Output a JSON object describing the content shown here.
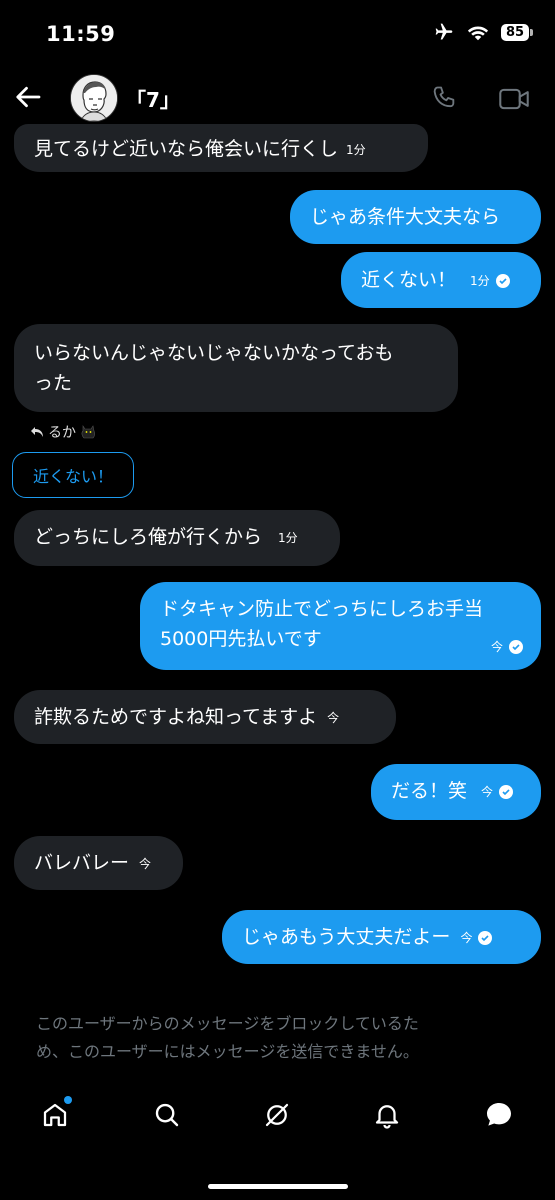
{
  "status": {
    "time": "11:59",
    "battery": "85"
  },
  "header": {
    "title": "「7」"
  },
  "messages": {
    "m1": {
      "text": "見てるけど近いなら俺会いに行くし",
      "time": "1分"
    },
    "m2": {
      "text": "じゃあ条件大文夫なら"
    },
    "m3": {
      "text": "近くない！",
      "time": "1分"
    },
    "m4": {
      "line1": "いらないんじゃないじゃないかなっておも",
      "line2": "った"
    },
    "reply_ref": "るか",
    "quote": "近くない！",
    "m5": {
      "text": "どっちにしろ俺が行くから",
      "time": "1分"
    },
    "m6": {
      "line1": "ドタキャン防止でどっちにしろお手当",
      "line2": "5000円先払いです",
      "time": "今"
    },
    "m7": {
      "text": "詐欺るためですよね知ってますよ",
      "time": "今"
    },
    "m8": {
      "text": "だる！笑",
      "time": "今"
    },
    "m9": {
      "text": "バレバレー",
      "time": "今"
    },
    "m10": {
      "text": "じゃあもう大丈夫だよー",
      "time": "今"
    }
  },
  "blocked_notice": {
    "line1": "このユーザーからのメッセージをブロックしているた",
    "line2": "め、このユーザーにはメッセージを送信できません。"
  },
  "icons": [
    "back-arrow-icon",
    "phone-icon",
    "video-icon",
    "airplane-icon",
    "wifi-icon",
    "battery-icon",
    "home-icon",
    "search-icon",
    "grok-icon",
    "bell-icon",
    "messages-icon",
    "reply-icon",
    "cat-emoji"
  ],
  "colors": {
    "accent": "#1d9bf0",
    "incoming": "#1f2226",
    "muted": "#6e767d"
  }
}
